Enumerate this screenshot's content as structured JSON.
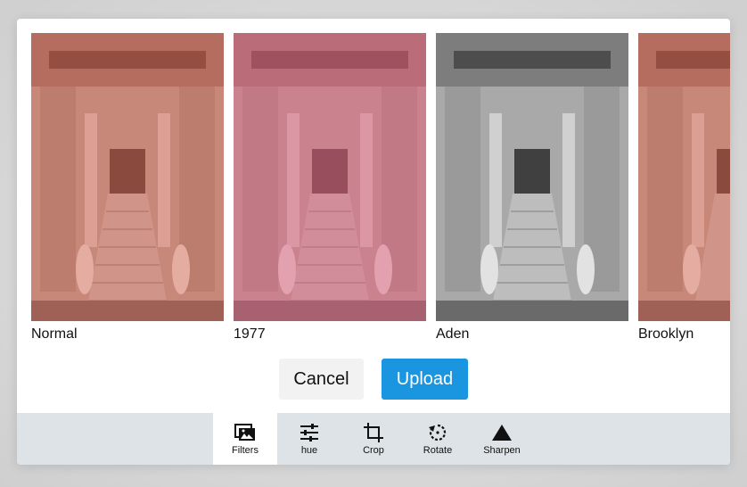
{
  "filters": [
    {
      "label": "Normal",
      "tint": "#e2564a",
      "tint_opacity": 0.35,
      "grayscale": false
    },
    {
      "label": "1977",
      "tint": "#e05a8a",
      "tint_opacity": 0.45,
      "grayscale": false
    },
    {
      "label": "Aden",
      "tint": "#bdbdbd",
      "tint_opacity": 0.0,
      "grayscale": true
    },
    {
      "label": "Brooklyn",
      "tint": "#e2564a",
      "tint_opacity": 0.35,
      "grayscale": false
    }
  ],
  "actions": {
    "cancel_label": "Cancel",
    "upload_label": "Upload"
  },
  "toolbar": {
    "items": [
      {
        "label": "Filters",
        "icon": "image-icon",
        "active": true
      },
      {
        "label": "hue",
        "icon": "sliders-icon",
        "active": false
      },
      {
        "label": "Crop",
        "icon": "crop-icon",
        "active": false
      },
      {
        "label": "Rotate",
        "icon": "rotate-icon",
        "active": false
      },
      {
        "label": "Sharpen",
        "icon": "triangle-icon",
        "active": false
      }
    ]
  },
  "colors": {
    "accent": "#1a95e0",
    "toolbar_bg": "#dde3e7"
  }
}
